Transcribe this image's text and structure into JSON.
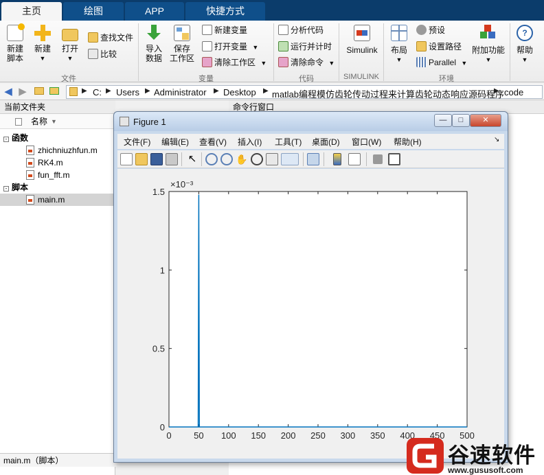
{
  "tabs": [
    {
      "label": "主页",
      "active": true
    },
    {
      "label": "绘图",
      "active": false
    },
    {
      "label": "APP",
      "active": false
    },
    {
      "label": "快捷方式",
      "active": false
    }
  ],
  "ribbon": {
    "file": {
      "group_label": "文件",
      "new_script": {
        "line1": "新建",
        "line2": "脚本"
      },
      "new": "新建",
      "open": "打开",
      "find_files": "查找文件",
      "compare": "比较"
    },
    "variable": {
      "group_label": "变量",
      "import": {
        "line1": "导入",
        "line2": "数据"
      },
      "save_ws": {
        "line1": "保存",
        "line2": "工作区"
      },
      "new_var": "新建变量",
      "open_var": "打开变量",
      "clear_ws": "清除工作区"
    },
    "code": {
      "group_label": "代码",
      "analyze": "分析代码",
      "run_time": "运行并计时",
      "clear_cmd": "清除命令"
    },
    "simulink": {
      "group_label": "SIMULINK",
      "label": "Simulink"
    },
    "env": {
      "group_label": "环境",
      "layout": "布局",
      "prefs": "预设",
      "set_path": "设置路径",
      "parallel": "Parallel",
      "addons": "附加功能",
      "help": "帮助"
    }
  },
  "address": {
    "crumbs": [
      "C:",
      "Users",
      "Administrator",
      "Desktop",
      "matlab编程模仿齿轮传动过程来计算齿轮动态响应源码程序",
      "code"
    ]
  },
  "left_panel": {
    "title": "当前文件夹",
    "col_name": "名称",
    "group_functions": "函数",
    "functions": [
      "zhichniuzhfun.m",
      "RK4.m",
      "fun_fft.m"
    ],
    "group_scripts": "脚本",
    "scripts": [
      "main.m"
    ],
    "status": "main.m（脚本）"
  },
  "command_window": {
    "title": "命令行窗口"
  },
  "figure": {
    "title": "Figure 1",
    "menus": [
      "文件(F)",
      "编辑(E)",
      "查看(V)",
      "插入(I)",
      "工具(T)",
      "桌面(D)",
      "窗口(W)",
      "帮助(H)"
    ]
  },
  "chart_data": {
    "type": "line",
    "title": "",
    "xlabel": "",
    "ylabel": "",
    "exponent_label": "×10⁻³",
    "xlim": [
      0,
      500
    ],
    "ylim": [
      0,
      0.0015
    ],
    "xticks": [
      0,
      50,
      100,
      150,
      200,
      250,
      300,
      350,
      400,
      450,
      500
    ],
    "yticks": [
      0,
      0.5,
      1,
      1.5
    ],
    "ytick_labels": [
      "0",
      "0.5",
      "1",
      "1.5"
    ],
    "grid": false,
    "color": "#0072bd",
    "series": [
      {
        "x": [
          0,
          49,
          50,
          51,
          500
        ],
        "y": [
          0,
          0,
          0.00148,
          0,
          0
        ]
      }
    ]
  },
  "watermark": {
    "text": "谷速软件",
    "url": "www.gususoft.com",
    "color": "#d52b1e"
  }
}
